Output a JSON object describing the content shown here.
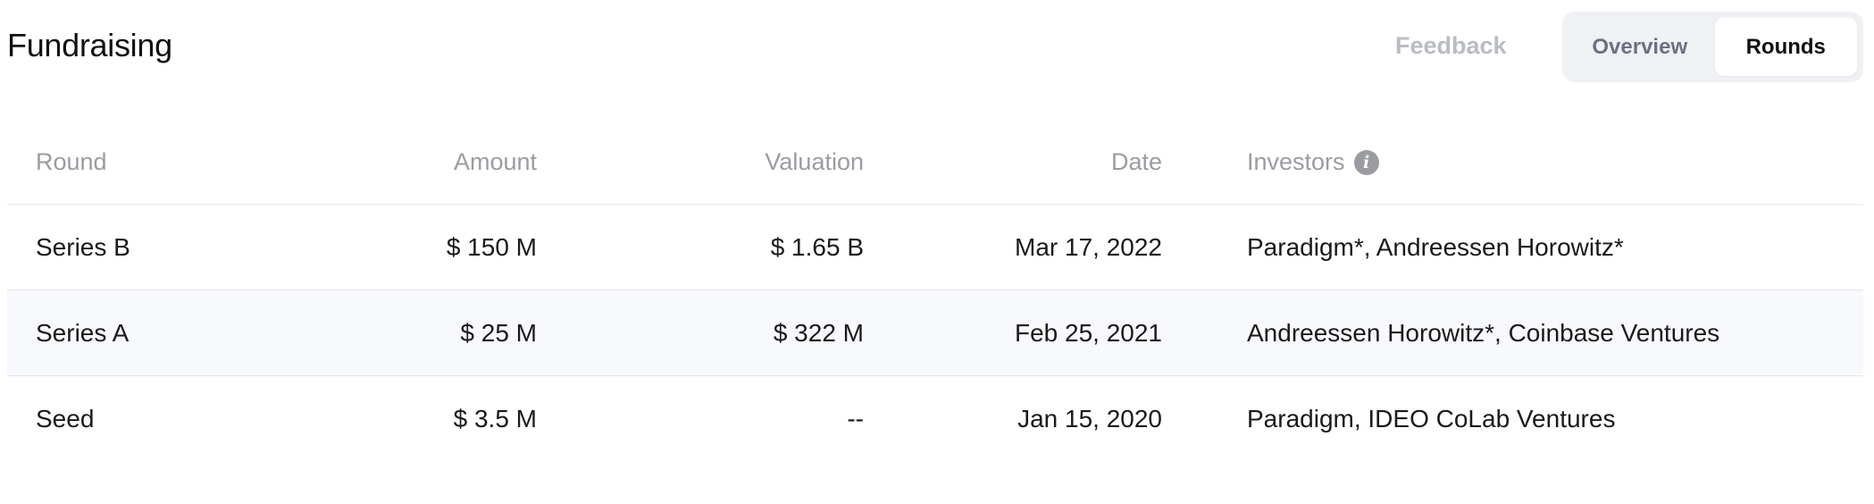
{
  "header": {
    "title": "Fundraising",
    "feedback_label": "Feedback",
    "tabs": [
      {
        "label": "Overview",
        "active": false
      },
      {
        "label": "Rounds",
        "active": true
      }
    ]
  },
  "table": {
    "columns": {
      "round": "Round",
      "amount": "Amount",
      "valuation": "Valuation",
      "date": "Date",
      "investors": "Investors"
    },
    "info_icon_glyph": "i",
    "rows": [
      {
        "round": "Series B",
        "amount": "$ 150 M",
        "valuation": "$ 1.65 B",
        "date": "Mar 17, 2022",
        "investors": "Paradigm*, Andreessen Horowitz*"
      },
      {
        "round": "Series A",
        "amount": "$ 25 M",
        "valuation": "$ 322 M",
        "date": "Feb 25, 2021",
        "investors": "Andreessen Horowitz*, Coinbase Ventures"
      },
      {
        "round": "Seed",
        "amount": "$ 3.5 M",
        "valuation": "--",
        "date": "Jan 15, 2020",
        "investors": "Paradigm, IDEO CoLab Ventures"
      }
    ]
  },
  "colors": {
    "alt_row_bg": "#f8f9fc",
    "header_text": "#9a9ca1",
    "muted_link": "#b9bcc2",
    "segment_bg": "#f0f1f5"
  }
}
